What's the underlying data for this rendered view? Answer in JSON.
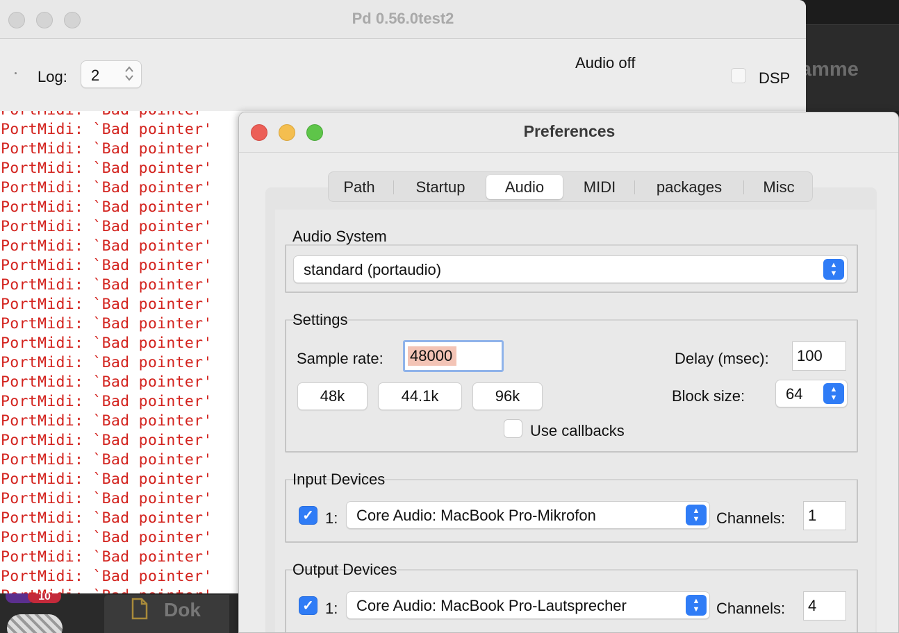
{
  "pd_window": {
    "title": "Pd 0.56.0test2",
    "log_label": "Log:",
    "log_level": "2",
    "audio_status": "Audio off",
    "dsp_label": "DSP",
    "dsp_checked": false,
    "log_lines": [
      "PortMidi: `Bad pointer'",
      "PortMidi: `Bad pointer'",
      "PortMidi: `Bad pointer'",
      "PortMidi: `Bad pointer'",
      "PortMidi: `Bad pointer'",
      "PortMidi: `Bad pointer'",
      "PortMidi: `Bad pointer'",
      "PortMidi: `Bad pointer'",
      "PortMidi: `Bad pointer'",
      "PortMidi: `Bad pointer'",
      "PortMidi: `Bad pointer'",
      "PortMidi: `Bad pointer'",
      "PortMidi: `Bad pointer'",
      "PortMidi: `Bad pointer'",
      "PortMidi: `Bad pointer'",
      "PortMidi: `Bad pointer'",
      "PortMidi: `Bad pointer'",
      "PortMidi: `Bad pointer'",
      "PortMidi: `Bad pointer'",
      "PortMidi: `Bad pointer'",
      "PortMidi: `Bad pointer'",
      "PortMidi: `Bad pointer'",
      "PortMidi: `Bad pointer'",
      "PortMidi: `Bad pointer'",
      "PortMidi: `Bad pointer'",
      "PortMidi: `Bad pointer'"
    ],
    "log_color": "#d3231e"
  },
  "background": {
    "app_text": "amme",
    "dock_doc_label": "Dok",
    "dock_badge": "10"
  },
  "prefs": {
    "title": "Preferences",
    "tabs": [
      {
        "label": "Path",
        "active": false
      },
      {
        "label": "Startup",
        "active": false
      },
      {
        "label": "Audio",
        "active": true
      },
      {
        "label": "MIDI",
        "active": false
      },
      {
        "label": "packages",
        "active": false
      },
      {
        "label": "Misc",
        "active": false
      }
    ],
    "audio_system": {
      "group_label": "Audio System",
      "selected": "standard (portaudio)"
    },
    "settings": {
      "group_label": "Settings",
      "sample_rate_label": "Sample rate:",
      "sample_rate_value": "48000",
      "rate_buttons": [
        "48k",
        "44.1k",
        "96k"
      ],
      "delay_label": "Delay (msec):",
      "delay_value": "100",
      "block_size_label": "Block size:",
      "block_size_value": "64",
      "use_callbacks_label": "Use callbacks",
      "use_callbacks_checked": false
    },
    "input_devices": {
      "group_label": "Input Devices",
      "checked": true,
      "index_label": "1:",
      "device": "Core Audio: MacBook Pro-Mikrofon",
      "channels_label": "Channels:",
      "channels_value": "1"
    },
    "output_devices": {
      "group_label": "Output Devices",
      "checked": true,
      "index_label": "1:",
      "device": "Core Audio: MacBook Pro-Lautsprecher",
      "channels_label": "Channels:",
      "channels_value": "4"
    },
    "accent_color": "#2f7cf6"
  }
}
